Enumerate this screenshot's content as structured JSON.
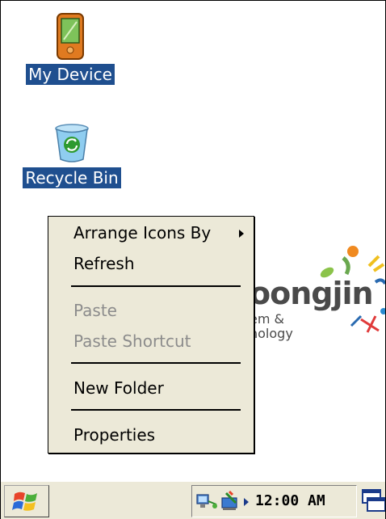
{
  "desktop": {
    "icons": [
      {
        "label": "My Device",
        "icon": "pda-device-icon"
      },
      {
        "label": "Recycle Bin",
        "icon": "recycle-bin-icon"
      }
    ],
    "wallpaper": {
      "logo_main": "oongjin",
      "logo_line1": "em &",
      "logo_line2": "nology"
    }
  },
  "context_menu": {
    "items": [
      {
        "label": "Arrange Icons By",
        "enabled": true,
        "submenu": true
      },
      {
        "label": "Refresh",
        "enabled": true
      },
      {
        "label": "Paste",
        "enabled": false
      },
      {
        "label": "Paste Shortcut",
        "enabled": false
      },
      {
        "label": "New Folder",
        "enabled": true
      },
      {
        "label": "Properties",
        "enabled": true
      }
    ]
  },
  "taskbar": {
    "start_icon": "windows-flag-icon",
    "tray_icons": [
      "network-icon",
      "connection-status-icon"
    ],
    "clock": "12:00 AM",
    "desktop_icon": "show-desktop-icon"
  },
  "colors": {
    "selection": "#1f4f8f",
    "menu_bg": "#ece9d8",
    "disabled_text": "#8c8c8c"
  }
}
